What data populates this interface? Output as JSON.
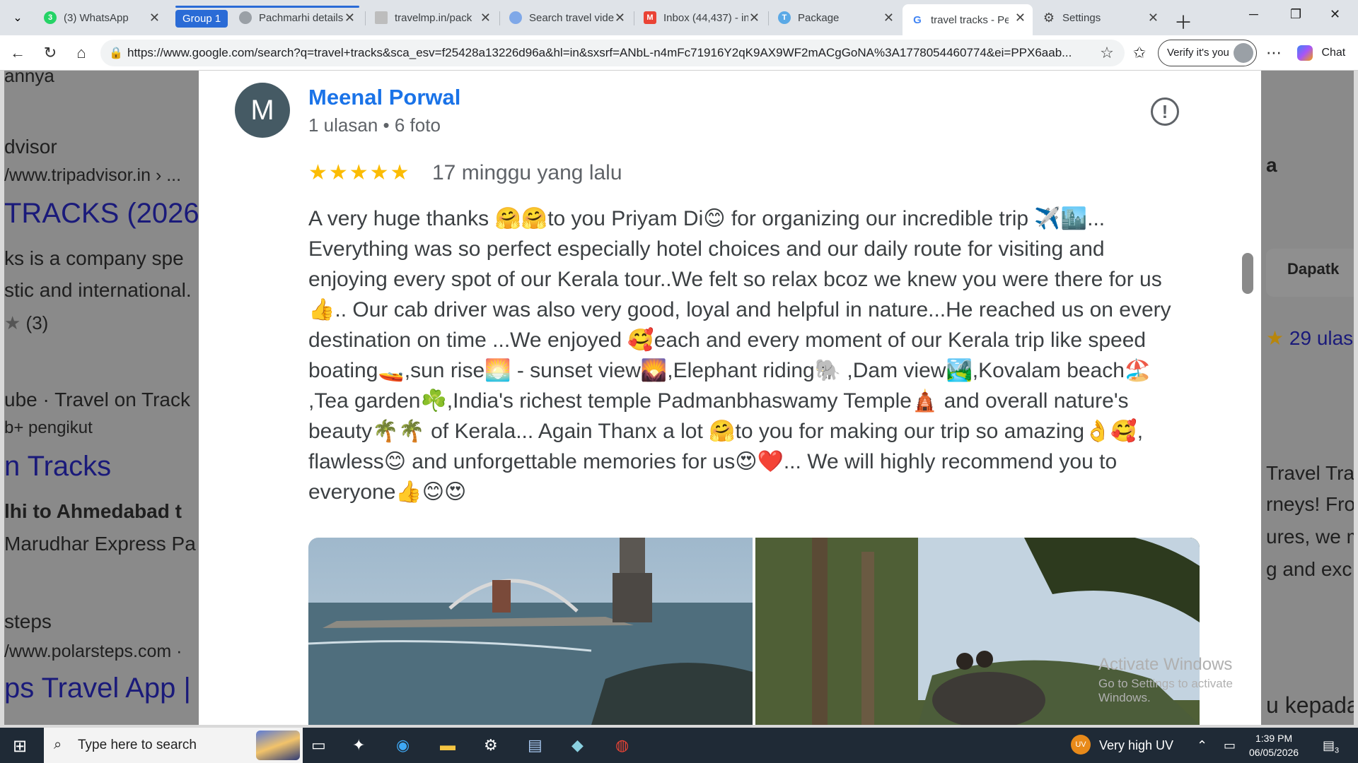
{
  "browser": {
    "tabs": [
      {
        "label": "(3) WhatsApp",
        "favicon": "whatsapp-icon"
      },
      {
        "label": "Pachmarhi details",
        "favicon": "globe-icon"
      },
      {
        "label": "travelmp.in/pack",
        "favicon": "page-icon"
      },
      {
        "label": "Search travel vide",
        "favicon": "search-icon"
      },
      {
        "label": "Inbox (44,437) - in",
        "favicon": "gmail-icon"
      },
      {
        "label": "Package",
        "favicon": "t-icon"
      },
      {
        "label": "travel tracks - Pen",
        "favicon": "google-icon"
      },
      {
        "label": "Settings",
        "favicon": "gear-icon"
      }
    ],
    "whatsapp_badge": "3",
    "group_label": "Group 1",
    "url": "https://www.google.com/search?q=travel+tracks&sca_esv=f25428a13226d96a&hl=in&sxsrf=ANbL-n4mFc71916Y2qK9AX9WF2mACgGoNA%3A1778054460774&ei=PPX6aab...",
    "verify_label": "Verify it's you",
    "chat_label": "Chat"
  },
  "background": {
    "left": [
      "annya",
      "dvisor",
      "/www.tripadvisor.in › ...",
      "TRACKS (2026",
      "ks is a company spe",
      "stic and international.",
      "(3)",
      "ube · Travel on Track",
      "b+ pengikut",
      "n Tracks",
      "lhi to Ahmedabad t",
      "Marudhar Express Pa",
      "steps",
      "/www.polarsteps.com  ·",
      "ps Travel App |"
    ],
    "right": [
      "a",
      "Dapatk",
      "29 ulas",
      "Travel Trac",
      "rneys! Fro",
      "ures, we m",
      "g and exc",
      "u kepada"
    ]
  },
  "review": {
    "avatar_letter": "M",
    "reviewer_name": "Meenal Porwal",
    "reviewer_meta": "1 ulasan • 6 foto",
    "stars": "★★★★★",
    "rating": 5,
    "date": "17 minggu yang lalu",
    "text": "A very huge thanks 🤗🤗to you Priyam Di😊 for organizing our incredible trip ✈️🏙️... Everything was so perfect especially hotel choices and our daily route for visiting and enjoying every spot of our Kerala tour..We felt so relax bcoz we knew you were there for us 👍.. Our cab driver was also very good, loyal and helpful in nature...He reached us on every destination on time ...We enjoyed 🥰each and every moment of our Kerala trip like speed boating🚤,sun rise🌅 - sunset view🌄,Elephant riding🐘 ,Dam view🏞️,Kovalam beach🏖️ ,Tea garden☘️,India's richest temple Padmanbhaswamy Temple🛕 and overall nature's beauty🌴🌴 of Kerala... Again Thanx a lot 🤗to you for making our trip so amazing👌🥰, flawless😊 and unforgettable memories for us😍❤️... We will highly recommend you to everyone👍😊😍"
  },
  "watermark": {
    "line1": "Activate Windows",
    "line2": "Go to Settings to activate Windows."
  },
  "taskbar": {
    "search_placeholder": "Type here to search",
    "weather": "Very high UV",
    "uv_badge": "UV",
    "time": "1:39 PM",
    "date": "06/05/2026",
    "notifications": "3"
  }
}
